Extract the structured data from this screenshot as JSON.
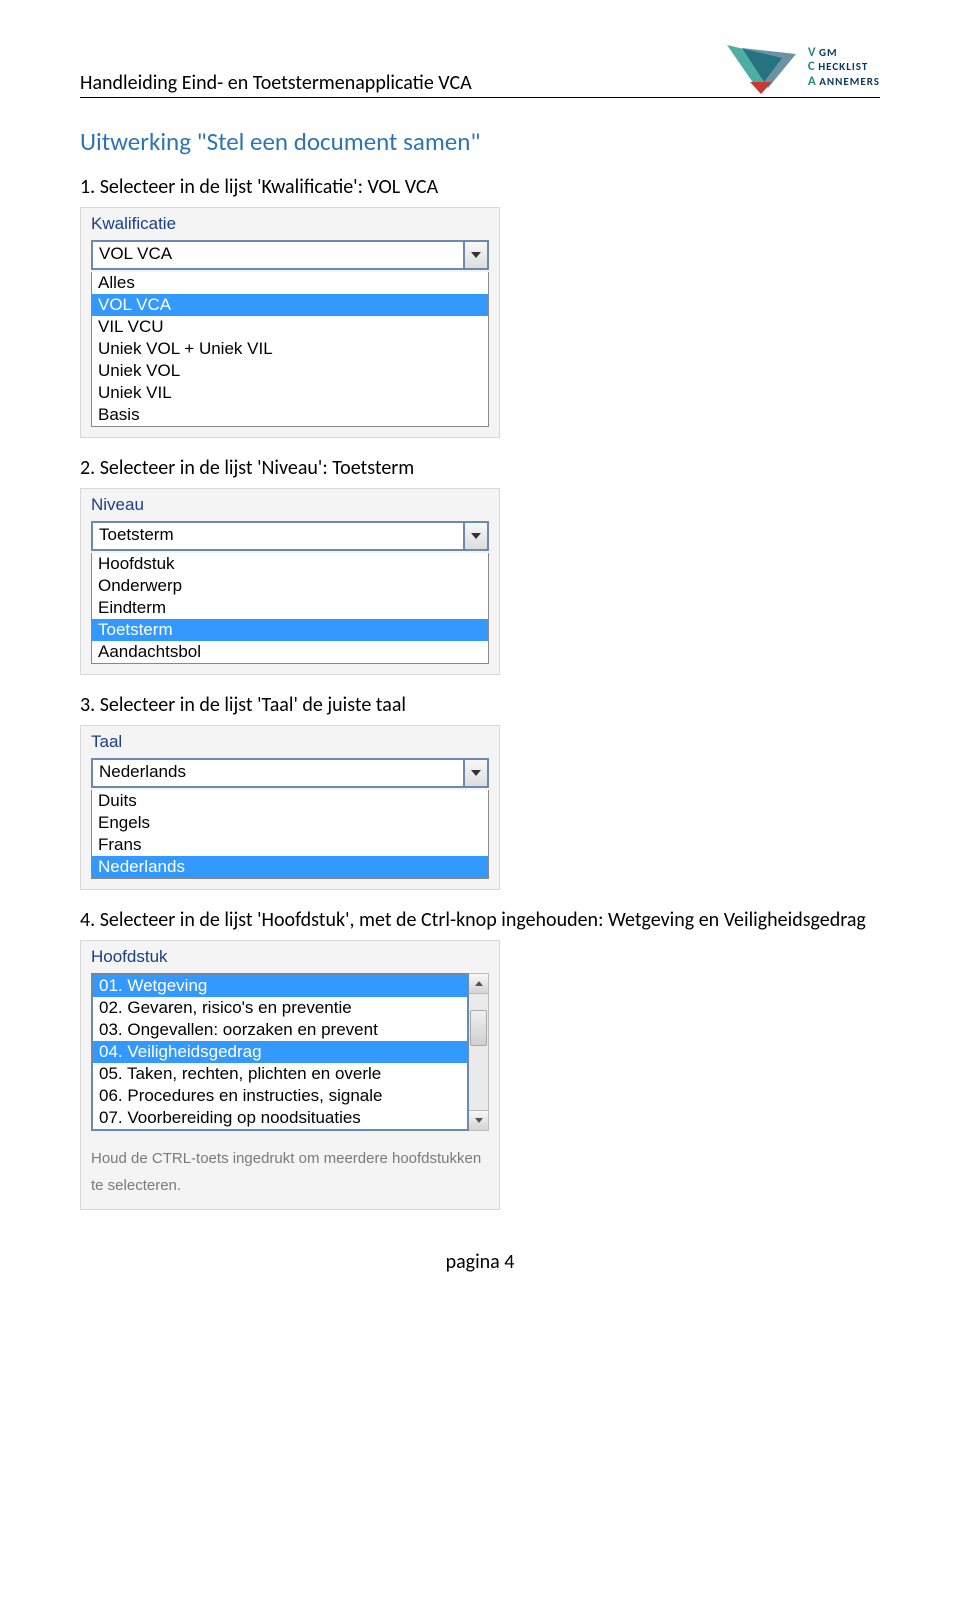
{
  "header": {
    "title": "Handleiding Eind- en Toetstermenapplicatie VCA",
    "logo": {
      "lines": [
        {
          "v": "V",
          "rest": " GM"
        },
        {
          "v": "C",
          "rest": " HECKLIST"
        },
        {
          "v": "A",
          "rest": " ANNEMERS"
        }
      ]
    }
  },
  "section_title": "Uitwerking \"Stel een document samen\"",
  "steps": [
    {
      "text": "1.   Selecteer in de lijst 'Kwalificatie': VOL VCA",
      "widget": {
        "label": "Kwalificatie",
        "value": "VOL VCA",
        "options": [
          {
            "label": "Alles",
            "selected": false
          },
          {
            "label": "VOL VCA",
            "selected": true
          },
          {
            "label": "VIL VCU",
            "selected": false
          },
          {
            "label": "Uniek VOL + Uniek VIL",
            "selected": false
          },
          {
            "label": "Uniek VOL",
            "selected": false
          },
          {
            "label": "Uniek VIL",
            "selected": false
          },
          {
            "label": "Basis",
            "selected": false
          }
        ]
      }
    },
    {
      "text": "2.   Selecteer in de lijst 'Niveau': Toetsterm",
      "widget": {
        "label": "Niveau",
        "value": "Toetsterm",
        "options": [
          {
            "label": "Hoofdstuk",
            "selected": false
          },
          {
            "label": "Onderwerp",
            "selected": false
          },
          {
            "label": "Eindterm",
            "selected": false
          },
          {
            "label": "Toetsterm",
            "selected": true
          },
          {
            "label": "Aandachtsbol",
            "selected": false
          }
        ]
      }
    },
    {
      "text": "3.   Selecteer in de lijst 'Taal' de juiste taal",
      "widget": {
        "label": "Taal",
        "value": "Nederlands",
        "options": [
          {
            "label": "Duits",
            "selected": false
          },
          {
            "label": "Engels",
            "selected": false
          },
          {
            "label": "Frans",
            "selected": false
          },
          {
            "label": "Nederlands",
            "selected": true
          }
        ]
      }
    },
    {
      "text": "4.   Selecteer in de lijst 'Hoofdstuk', met de Ctrl-knop ingehouden: Wetgeving en Veiligheidsgedrag",
      "widget": {
        "label": "Hoofdstuk",
        "multi": true,
        "options": [
          {
            "label": "01. Wetgeving",
            "selected": true
          },
          {
            "label": "02. Gevaren, risico's en preventie",
            "selected": false
          },
          {
            "label": "03. Ongevallen: oorzaken en prevent",
            "selected": false
          },
          {
            "label": "04. Veiligheidsgedrag",
            "selected": true
          },
          {
            "label": "05. Taken, rechten, plichten en overle",
            "selected": false
          },
          {
            "label": "06. Procedures en instructies, signale",
            "selected": false
          },
          {
            "label": "07. Voorbereiding op noodsituaties",
            "selected": false
          }
        ],
        "hint": "Houd de CTRL-toets ingedrukt om meerdere hoofdstukken te selecteren."
      }
    }
  ],
  "footer": "pagina 4"
}
